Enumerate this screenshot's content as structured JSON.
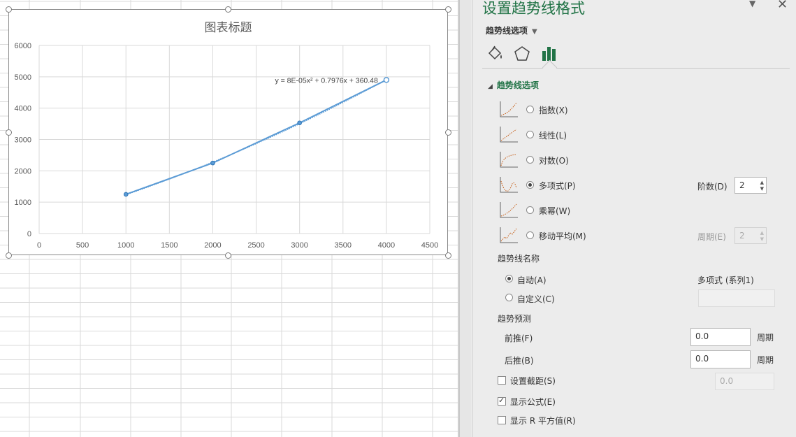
{
  "chart_data": {
    "type": "scatter",
    "title": "图表标题",
    "x": [
      1000,
      2000,
      3000,
      4000
    ],
    "y": [
      1250,
      2250,
      3530,
      4900
    ],
    "xlim": [
      0,
      4500
    ],
    "ylim": [
      0,
      6000
    ],
    "xticks": [
      "0",
      "500",
      "1000",
      "1500",
      "2000",
      "2500",
      "3000",
      "3500",
      "4000",
      "4500"
    ],
    "yticks": [
      "0",
      "1000",
      "2000",
      "3000",
      "4000",
      "5000",
      "6000"
    ],
    "grid": true,
    "trendline": {
      "type": "polynomial",
      "order": 2,
      "equation": "y = 8E-05x² + 0.7976x + 360.48"
    },
    "series_color": "#5b9bd5"
  },
  "pane": {
    "title": "设置趋势线格式",
    "options_dropdown": "趋势线选项",
    "section_header": "趋势线选项",
    "trend_types": [
      {
        "label": "指数(X)",
        "selected": false
      },
      {
        "label": "线性(L)",
        "selected": false
      },
      {
        "label": "对数(O)",
        "selected": false
      },
      {
        "label": "多项式(P)",
        "selected": true
      },
      {
        "label": "乘幂(W)",
        "selected": false
      },
      {
        "label": "移动平均(M)",
        "selected": false
      }
    ],
    "order_label": "阶数(D)",
    "order_value": "2",
    "period_label": "周期(E)",
    "period_value": "2",
    "name_section": "趋势线名称",
    "name_auto_label": "自动(A)",
    "name_auto_value": "多项式 (系列1)",
    "name_custom_label": "自定义(C)",
    "forecast_section": "趋势预测",
    "forward_label": "前推(F)",
    "forward_value": "0.0",
    "forward_unit": "周期",
    "backward_label": "后推(B)",
    "backward_value": "0.0",
    "backward_unit": "周期",
    "intercept_label": "设置截距(S)",
    "intercept_value": "0.0",
    "show_equation_label": "显示公式(E)",
    "show_r2_label": "显示 R 平方值(R)",
    "accent_color": "#217346"
  }
}
